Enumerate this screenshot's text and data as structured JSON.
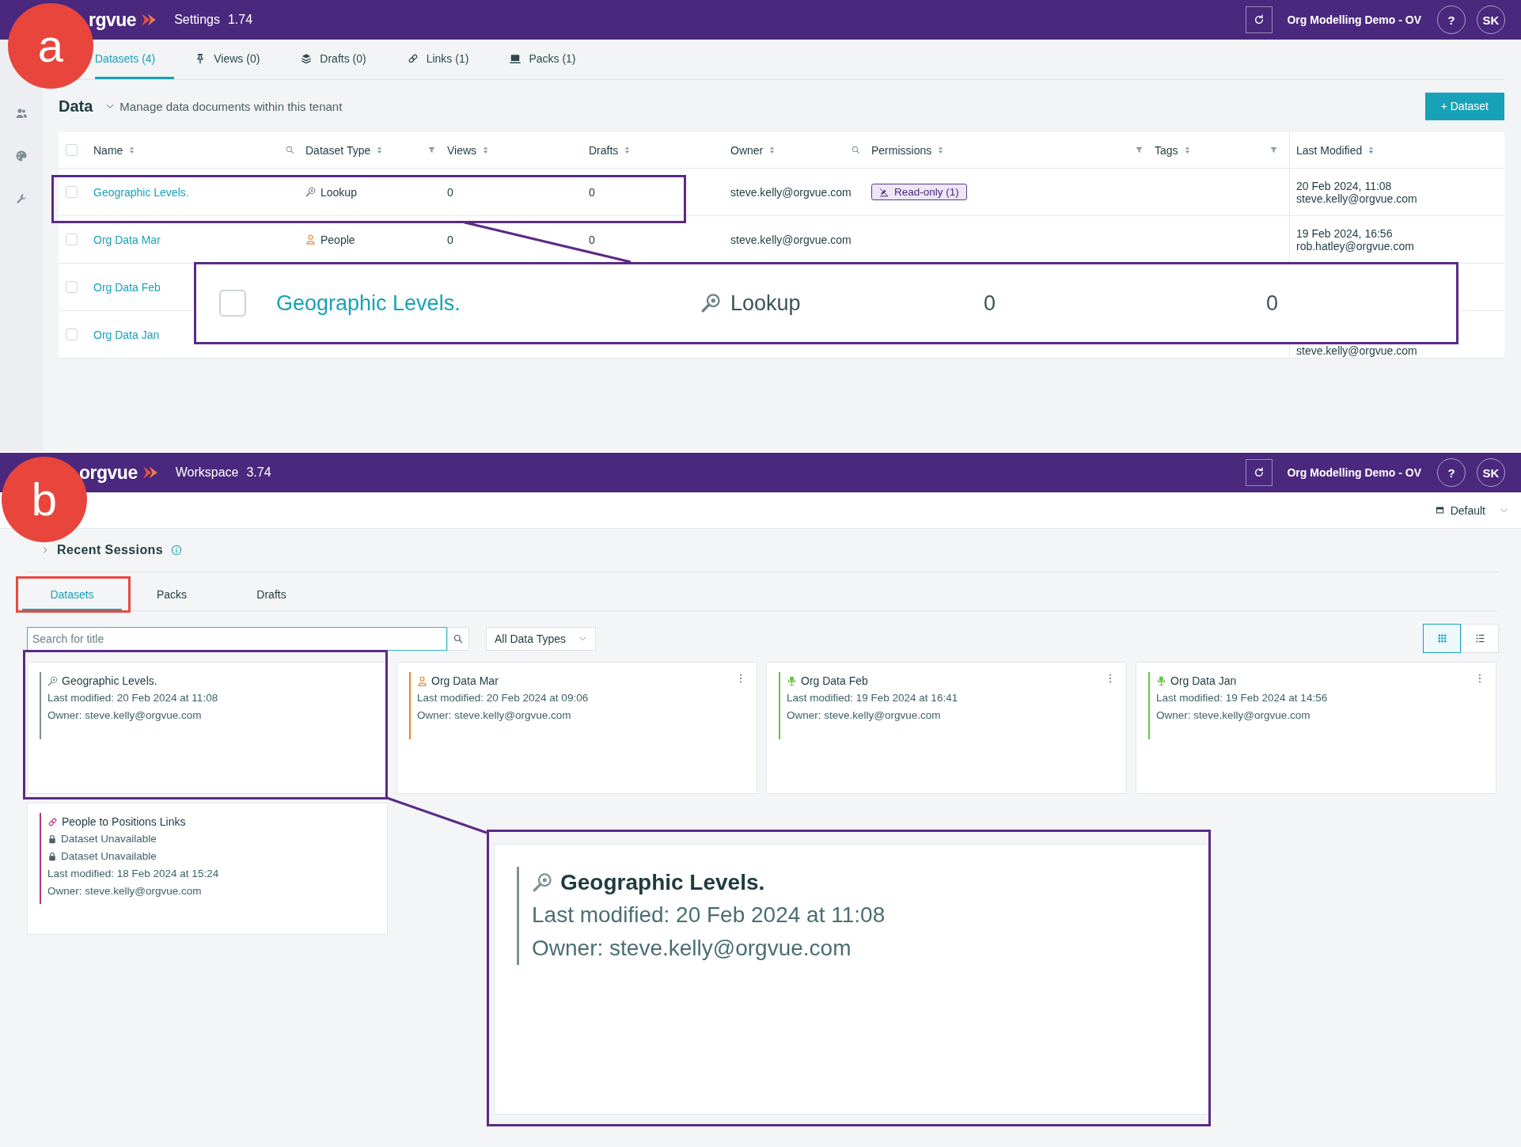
{
  "panel_a": {
    "marker": "a",
    "header": {
      "logo": "rgvue",
      "app": "Settings",
      "version": "1.74",
      "tenant": "Org Modelling Demo - OV",
      "help": "?",
      "user": "SK"
    },
    "tabs": [
      {
        "label": "Datasets (4)",
        "selected": true
      },
      {
        "label": "Views (0)",
        "selected": false
      },
      {
        "label": "Drafts (0)",
        "selected": false
      },
      {
        "label": "Links (1)",
        "selected": false
      },
      {
        "label": "Packs (1)",
        "selected": false
      }
    ],
    "title": "Data",
    "description": "Manage data documents within this tenant",
    "add_button": "+ Dataset",
    "table": {
      "select_all_checked": false,
      "columns": [
        {
          "label": "Name",
          "sorted": false,
          "kind": "search"
        },
        {
          "label": "Dataset Type",
          "sorted": false,
          "kind": "filter"
        },
        {
          "label": "Views",
          "sorted": false,
          "kind": "plain"
        },
        {
          "label": "Drafts",
          "sorted": false,
          "kind": "plain"
        },
        {
          "label": "Owner",
          "sorted": false,
          "kind": "search"
        },
        {
          "label": "Permissions",
          "sorted": false,
          "kind": "filter"
        },
        {
          "label": "Tags",
          "sorted": false,
          "kind": "filter"
        },
        {
          "label": "Last Modified",
          "sorted": true,
          "kind": "plain"
        }
      ],
      "rows": [
        {
          "checked": false,
          "name": "Geographic Levels.",
          "type": {
            "label": "Lookup",
            "kind": "lookup"
          },
          "views": "0",
          "drafts": "0",
          "owner": "steve.kelly@orgvue.com",
          "permission": "Read-only (1)",
          "modified": "20 Feb 2024, 11:08",
          "modified_by": "steve.kelly@orgvue.com"
        },
        {
          "checked": false,
          "name": "Org Data Mar",
          "type": {
            "label": "People",
            "kind": "people"
          },
          "views": "0",
          "drafts": "0",
          "owner": "steve.kelly@orgvue.com",
          "modified": "19 Feb 2024, 16:56",
          "modified_by": "rob.hatley@orgvue.com"
        },
        {
          "checked": false,
          "name": "Org Data Feb"
        },
        {
          "checked": false,
          "name": "Org Data Jan",
          "modified_by": "steve.kelly@orgvue.com"
        }
      ]
    },
    "inset": {
      "checked": false,
      "name": "Geographic Levels.",
      "type": {
        "label": "Lookup",
        "kind": "lookup"
      },
      "views": "0",
      "drafts": "0"
    }
  },
  "panel_b": {
    "marker": "b",
    "header": {
      "logo": "orgvue",
      "app": "Workspace",
      "version": "3.74",
      "tenant": "Org Modelling Demo - OV",
      "help": "?",
      "user": "SK"
    },
    "layout_menu": "Default",
    "section_title": "Recent Sessions",
    "tabs": [
      {
        "label": "Datasets",
        "selected": true
      },
      {
        "label": "Packs",
        "selected": false
      },
      {
        "label": "Drafts",
        "selected": false
      }
    ],
    "search": {
      "placeholder": "Search for title"
    },
    "type_filter": "All Data Types",
    "view_modes": [
      {
        "kind": "grid",
        "selected": true
      },
      {
        "kind": "list",
        "selected": false
      }
    ],
    "cards": [
      {
        "title": "Geographic Levels.",
        "kind": "lookup",
        "color": "#7f9296",
        "menu": false,
        "lines": [
          {
            "text": "Last modified: 20 Feb 2024 at 11:08",
            "kind": "plain"
          },
          {
            "text": "Owner: steve.kelly@orgvue.com",
            "kind": "plain"
          }
        ]
      },
      {
        "title": "Org Data Mar",
        "kind": "people",
        "color": "#e8842c",
        "menu": true,
        "lines": [
          {
            "text": "Last modified: 20 Feb 2024 at 09:06",
            "kind": "plain"
          },
          {
            "text": "Owner: steve.kelly@orgvue.com",
            "kind": "plain"
          }
        ]
      },
      {
        "title": "Org Data Feb",
        "kind": "org",
        "color": "#6cc04a",
        "menu": true,
        "lines": [
          {
            "text": "Last modified: 19 Feb 2024 at 16:41",
            "kind": "plain"
          },
          {
            "text": "Owner: steve.kelly@orgvue.com",
            "kind": "plain"
          }
        ]
      },
      {
        "title": "Org Data Jan",
        "kind": "org",
        "color": "#6cc04a",
        "menu": true,
        "lines": [
          {
            "text": "Last modified: 19 Feb 2024 at 14:56",
            "kind": "plain"
          },
          {
            "text": "Owner: steve.kelly@orgvue.com",
            "kind": "plain"
          }
        ]
      },
      {
        "title": "People to Positions Links",
        "kind": "links",
        "color": "#b5338a",
        "menu": false,
        "lines": [
          {
            "text": "Dataset Unavailable",
            "kind": "locked"
          },
          {
            "text": "Dataset Unavailable",
            "kind": "locked"
          },
          {
            "text": "Last modified: 18 Feb 2024 at 15:24",
            "kind": "plain"
          },
          {
            "text": "Owner: steve.kelly@orgvue.com",
            "kind": "plain"
          }
        ]
      }
    ],
    "inset": {
      "title": "Geographic Levels.",
      "kind": "lookup",
      "color": "#7f9296",
      "lines": [
        "Last modified: 20 Feb 2024 at 11:08",
        "Owner: steve.kelly@orgvue.com"
      ]
    }
  }
}
